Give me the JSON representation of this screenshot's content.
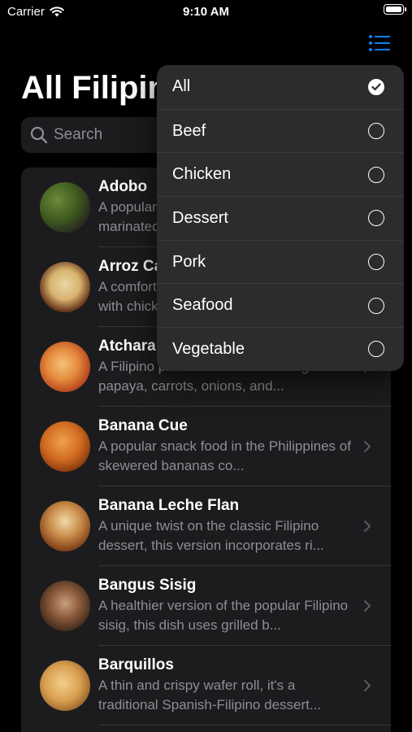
{
  "status_bar": {
    "carrier": "Carrier",
    "time": "9:10 AM"
  },
  "nav": {
    "title": "All Filipino Dishes"
  },
  "search": {
    "placeholder": "Search"
  },
  "dishes": [
    {
      "name": "Adobo",
      "description": "A popular Filipino dish made with meat marinated in vinegar, soy sauce, garlic...",
      "icon": "dish-photo"
    },
    {
      "name": "Arroz Caldo",
      "description": "A comforting Filipino rice porridge made with chicken, ginger and garlic...",
      "icon": "dish-photo"
    },
    {
      "name": "Atchara",
      "description": "A Filipino pickled dish made with green papaya, carrots, onions, and...",
      "icon": "dish-photo"
    },
    {
      "name": "Banana Cue",
      "description": "A popular snack food in the Philippines of skewered bananas co...",
      "icon": "dish-photo"
    },
    {
      "name": "Banana Leche Flan",
      "description": "A unique twist on the classic Filipino dessert, this version incorporates ri...",
      "icon": "dish-photo"
    },
    {
      "name": "Bangus Sisig",
      "description": "A healthier version of the popular Filipino sisig, this dish uses grilled b...",
      "icon": "dish-photo"
    },
    {
      "name": "Barquillos",
      "description": "A thin and crispy wafer roll, it's a traditional Spanish-Filipino dessert...",
      "icon": "dish-photo"
    }
  ],
  "filter_menu": {
    "items": [
      {
        "label": "All",
        "selected": true
      },
      {
        "label": "Beef",
        "selected": false
      },
      {
        "label": "Chicken",
        "selected": false
      },
      {
        "label": "Dessert",
        "selected": false
      },
      {
        "label": "Pork",
        "selected": false
      },
      {
        "label": "Seafood",
        "selected": false
      },
      {
        "label": "Vegetable",
        "selected": false
      }
    ]
  },
  "colors": {
    "background": "#000000",
    "card": "#1c1c1e",
    "menu": "#2c2c2e",
    "secondary_text": "#8e8e93",
    "accent": "#0a84ff"
  }
}
